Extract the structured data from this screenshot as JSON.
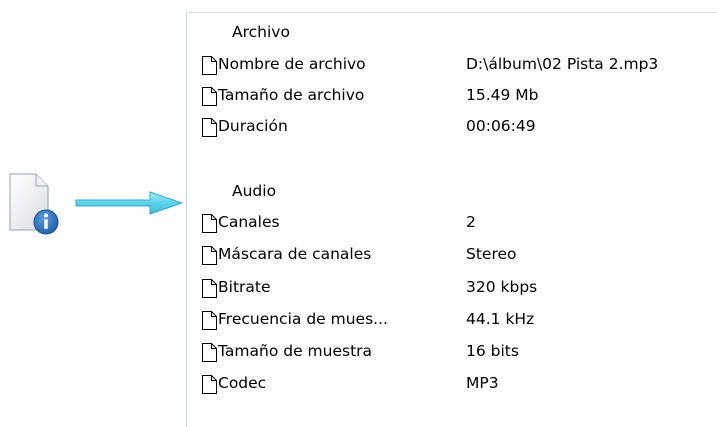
{
  "icons": {
    "file_info": "file-info-icon",
    "arrow": "arrow-right-icon",
    "property": "document-icon"
  },
  "colors": {
    "info_badge": "#1f5fa8",
    "arrow": "#5ad2ea",
    "panel_border": "#c8cdd3"
  },
  "groups": [
    {
      "name": "Archivo",
      "rows": [
        {
          "name": "Nombre de archivo",
          "value": "D:\\álbum\\02 Pista 2.mp3"
        },
        {
          "name": "Tamaño de archivo",
          "value": "15.49 Mb"
        },
        {
          "name": "Duración",
          "value": "00:06:49"
        }
      ]
    },
    {
      "name": "Audio",
      "rows": [
        {
          "name": "Canales",
          "value": "2"
        },
        {
          "name": "Máscara de canales",
          "value": "Stereo"
        },
        {
          "name": "Bitrate",
          "value": "320 kbps"
        },
        {
          "name": "Frecuencia de mues...",
          "value": "44.1 kHz"
        },
        {
          "name": "Tamaño de muestra",
          "value": "16 bits"
        },
        {
          "name": "Codec",
          "value": "MP3"
        }
      ]
    }
  ]
}
